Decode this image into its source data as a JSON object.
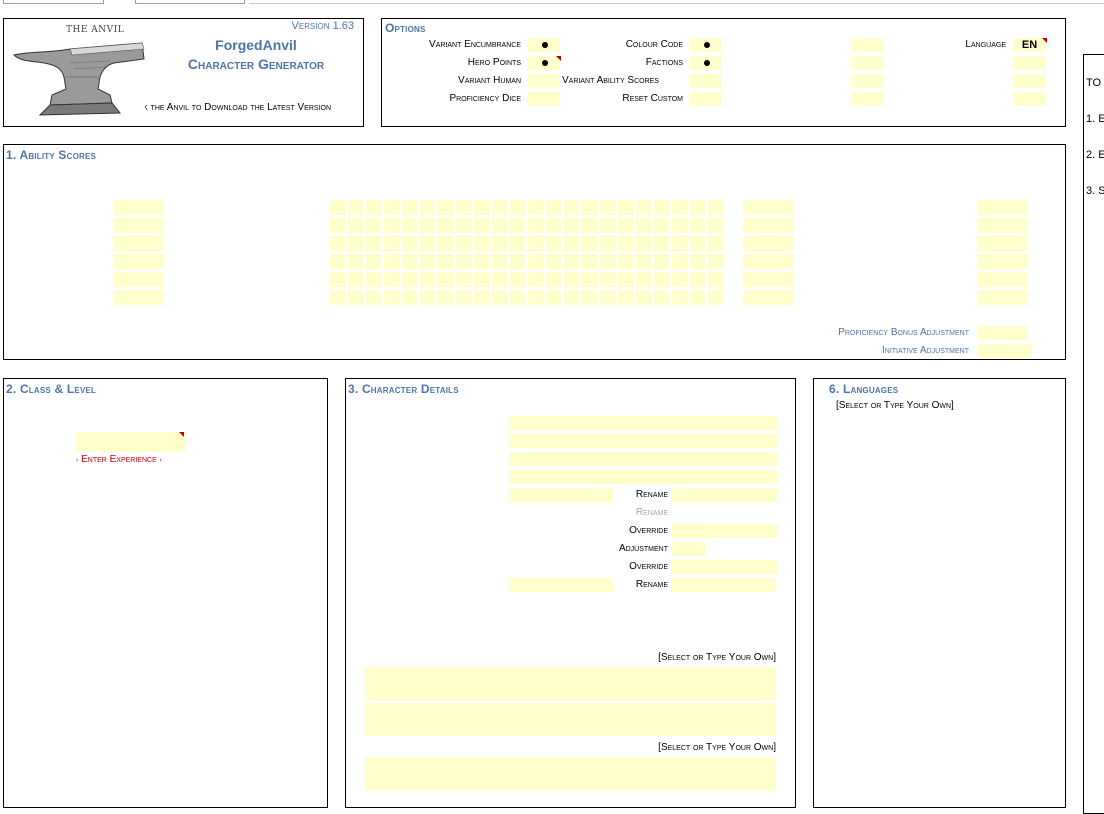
{
  "header": {
    "anvil_caption": "THE ANVIL",
    "version": "Version 1.63",
    "app_name": "ForgedAnvil",
    "app_subtitle": "Character Generator",
    "download_text": "Click the Anvil to Download the Latest Version"
  },
  "options": {
    "title": "Options",
    "variant_encumbrance": "Variant Encumbrance",
    "hero_points": "Hero Points",
    "variant_human": "Variant Human",
    "proficiency_dice": "Proficiency Dice",
    "colour_code": "Colour Code",
    "factions": "Factions",
    "variant_ability_scores": "Variant Ability Scores",
    "reset_custom": "Reset Custom",
    "language_label": "Language",
    "language_value": "EN"
  },
  "ability": {
    "title": "1. Ability Scores",
    "prof_bonus_adj": "Proficiency Bonus Adjustment",
    "initiative_adj": "Initiative Adjustment"
  },
  "class_level": {
    "title": "2. Class & Level",
    "enter_experience": "Enter Experience"
  },
  "details": {
    "title": "3. Character Details",
    "rename_1": "Rename",
    "rename_2": "Rename",
    "override_1": "Override",
    "adjustment": "Adjustment",
    "override_2": "Override",
    "rename_3": "Rename",
    "select_own_1": "[Select or Type Your Own]",
    "select_own_2": "[Select or Type Your Own]"
  },
  "languages": {
    "title": "6. Languages",
    "select_own": "[Select or Type Your Own]"
  },
  "side_panel": {
    "heading": "TO",
    "item_1": "1. E",
    "item_2": "2. E",
    "item_3": "3. S"
  },
  "colors": {
    "accent": "#4f74a8",
    "input_fill": "#ffffcc",
    "flag": "#c00000",
    "experience_text": "#c00000"
  }
}
